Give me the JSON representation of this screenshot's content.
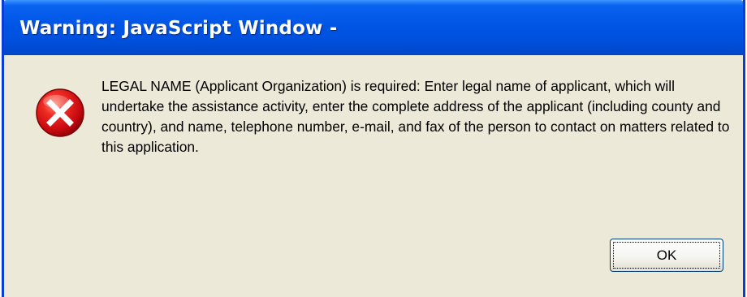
{
  "dialog": {
    "title": "Warning: JavaScript Window -",
    "icon": "error-icon",
    "message": "LEGAL NAME (Applicant Organization) is required: Enter legal name of applicant, which will undertake the assistance activity, enter the complete address of the applicant (including county and country), and name, telephone number, e-mail, and fax of the person to contact on matters related to this application.",
    "ok_label": "OK"
  },
  "colors": {
    "titlebar": "#0055e5",
    "window_body": "#ece9d8",
    "error_icon": "#d9101a"
  }
}
